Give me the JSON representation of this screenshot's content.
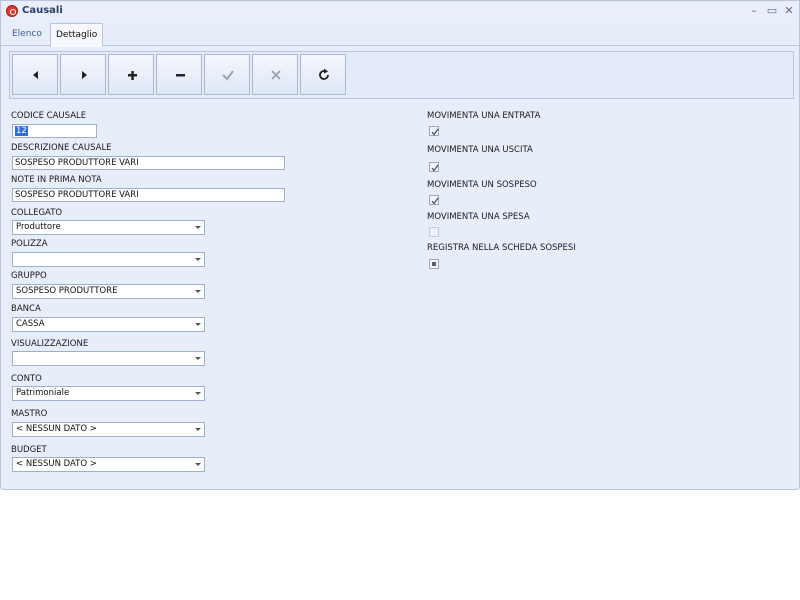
{
  "window": {
    "title": "Causali",
    "controls": {
      "minimize": "–",
      "maximize": "▭",
      "close": "✕"
    }
  },
  "tabs": [
    {
      "label": "Elenco"
    },
    {
      "label": "Dettaglio"
    }
  ],
  "toolbar": {
    "buttons": [
      {
        "icon": "arrow-left-icon"
      },
      {
        "icon": "arrow-right-icon"
      },
      {
        "icon": "plus-icon"
      },
      {
        "icon": "minus-icon"
      },
      {
        "icon": "check-icon"
      },
      {
        "icon": "cancel-icon"
      },
      {
        "icon": "refresh-icon"
      }
    ]
  },
  "form": {
    "codice_causale": {
      "label": "CODICE CAUSALE",
      "value": "12"
    },
    "descrizione_causale": {
      "label": "DESCRIZIONE CAUSALE",
      "value": "SOSPESO PRODUTTORE VARI"
    },
    "note_prima_nota": {
      "label": "NOTE IN PRIMA NOTA",
      "value": "SOSPESO PRODUTTORE VARI"
    },
    "collegato": {
      "label": "COLLEGATO",
      "value": "Produttore"
    },
    "polizza": {
      "label": "POLIZZA",
      "value": ""
    },
    "gruppo": {
      "label": "GRUPPO",
      "value": "SOSPESO PRODUTTORE"
    },
    "banca": {
      "label": "BANCA",
      "value": "CASSA"
    },
    "visualizzazione": {
      "label": "VISUALIZZAZIONE",
      "value": ""
    },
    "conto": {
      "label": "CONTO",
      "value": "Patrimoniale"
    },
    "mastro": {
      "label": "MASTRO",
      "value": "< NESSUN DATO >"
    },
    "budget": {
      "label": "BUDGET",
      "value": "< NESSUN DATO >"
    }
  },
  "checks": [
    {
      "label": "MOVIMENTA UNA ENTRATA",
      "state": "checked"
    },
    {
      "label": "MOVIMENTA UNA USCITA",
      "state": "checked"
    },
    {
      "label": "MOVIMENTA UN SOSPESO",
      "state": "checked"
    },
    {
      "label": "MOVIMENTA UNA SPESA",
      "state": "unchecked-disabled"
    },
    {
      "label": "REGISTRA NELLA SCHEDA SOSPESI",
      "state": "indeterminate"
    }
  ],
  "colors": {
    "window_bg": "#e7eefa",
    "accent": "#3270d8",
    "border": "#9db0d0"
  }
}
